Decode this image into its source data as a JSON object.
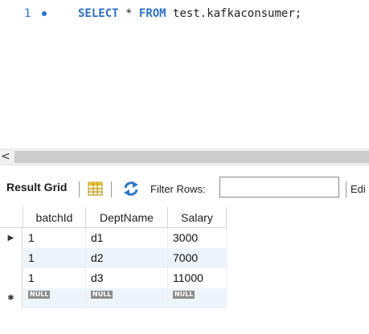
{
  "editor": {
    "line_number": "1",
    "sql": {
      "kw_select": "SELECT",
      "star": "*",
      "kw_from": "FROM",
      "table": "test.kafkaconsumer;"
    }
  },
  "scrollbar": {
    "left_arrow": "<"
  },
  "toolbar": {
    "result_grid_label": "Result Grid",
    "filter_rows_label": "Filter Rows:",
    "filter_value": "",
    "edit_label": "Edi"
  },
  "grid": {
    "columns": [
      "batchId",
      "DeptName",
      "Salary"
    ],
    "rows": [
      [
        "1",
        "d1",
        "3000"
      ],
      [
        "1",
        "d2",
        "7000"
      ],
      [
        "1",
        "d3",
        "11000"
      ]
    ],
    "null_label": "NULL",
    "current_row_marker": "▶",
    "new_row_marker": "✱"
  },
  "colors": {
    "keyword": "#2d6fc4",
    "line_number": "#2b6fd6",
    "row_alt": "#eef4fc",
    "null_badge": "#8b8b8b"
  }
}
